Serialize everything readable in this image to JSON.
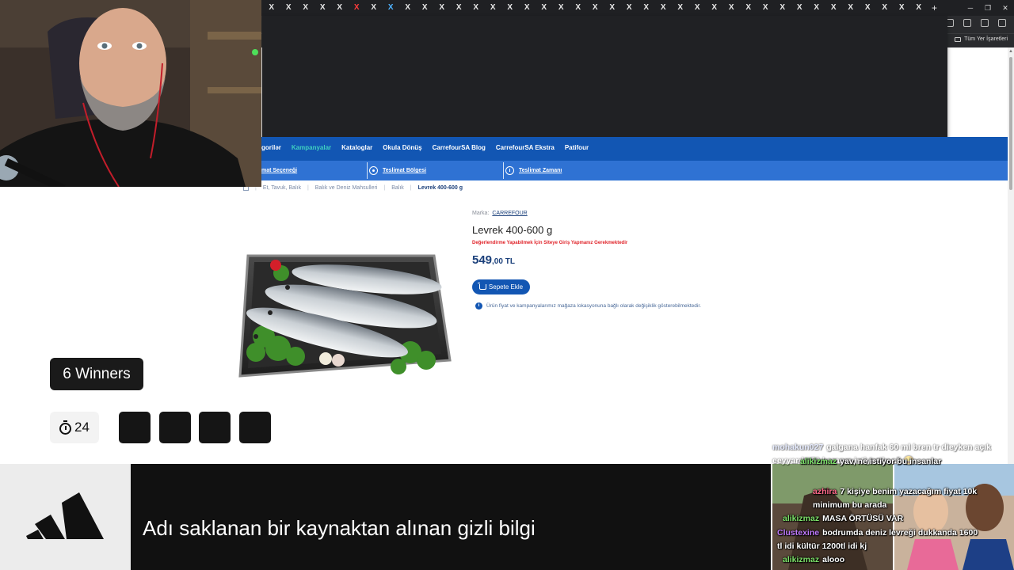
{
  "browser": {
    "tab_glyph": "X",
    "tab_count": 39,
    "new_tab_label": "+",
    "all_bookmarks_label": "Tüm Yer İşaretleri"
  },
  "site": {
    "nav": [
      "gorilər",
      "Kampanyalar",
      "Kataloglar",
      "Okula Dönüş",
      "CarrefourSA Blog",
      "CarrefourSA Ekstra",
      "Patifour"
    ],
    "nav_active_index": 1,
    "subnav": {
      "delivery_option": "mat Seçeneği",
      "delivery_region": "Teslimat Bölgesi",
      "delivery_time": "Teslimat Zamanı"
    },
    "breadcrumb": [
      "Et, Tavuk, Balık",
      "Balık ve Deniz Mahsulleri",
      "Balık",
      "Levrek 400-600 g"
    ],
    "breadcrumb_sep": "|",
    "colors": {
      "primary": "#1256b3",
      "subnav": "#2f72d3",
      "active_nav": "#3fd0c0",
      "warning": "#e0242a"
    }
  },
  "product": {
    "brand_label": "Marka:",
    "brand": "CARREFOUR",
    "title": "Levrek 400-600 g",
    "warning": "Değerlendirme Yapabilmek İçin Siteye Giriş Yapmanız Gerekmektedir",
    "price_main": "549",
    "price_decimal": ",00 TL",
    "add_to_cart": "Sepete Ekle",
    "info": "Ürün fiyat ve kampanyalarımız mağaza lokasyonuna bağlı olarak değişiklik gösterebilmektedir.",
    "image_icon": "fish-tray-image"
  },
  "stream": {
    "winners_label": "6 Winners",
    "timer_value": "24",
    "slot_count": 4,
    "ticker_text": "Adı saklanan bir kaynaktan alınan gizli bilgi",
    "logo": "adidas-logo"
  },
  "chat": [
    {
      "user": "mohakun027",
      "text": "galgana hanfak 60 ml bren tr dieyken açık eeyyarda 50 karanın istiyordu ağ 😂",
      "color": "#c8d4ff",
      "faded": true
    },
    {
      "user": "alikizmaz",
      "text": "yav, ne istiyor bu insanlar",
      "color": "#7ee36a"
    },
    {
      "user": "azhira",
      "text": "7 kişiye benim yazacağım fiyat 10k minimum bu arada",
      "color": "#ff6a8a"
    },
    {
      "user": "alikizmaz",
      "text": "MASA ÖRTÜSÜ VAR",
      "color": "#7ee36a"
    },
    {
      "user": "Clustexine",
      "text": "bodrumda deniz levreği dukkanda 1600 tl idi kültür 1200tl idi kj",
      "color": "#c07aff"
    },
    {
      "user": "alikizmaz",
      "text": "alooo",
      "color": "#7ee36a"
    }
  ]
}
